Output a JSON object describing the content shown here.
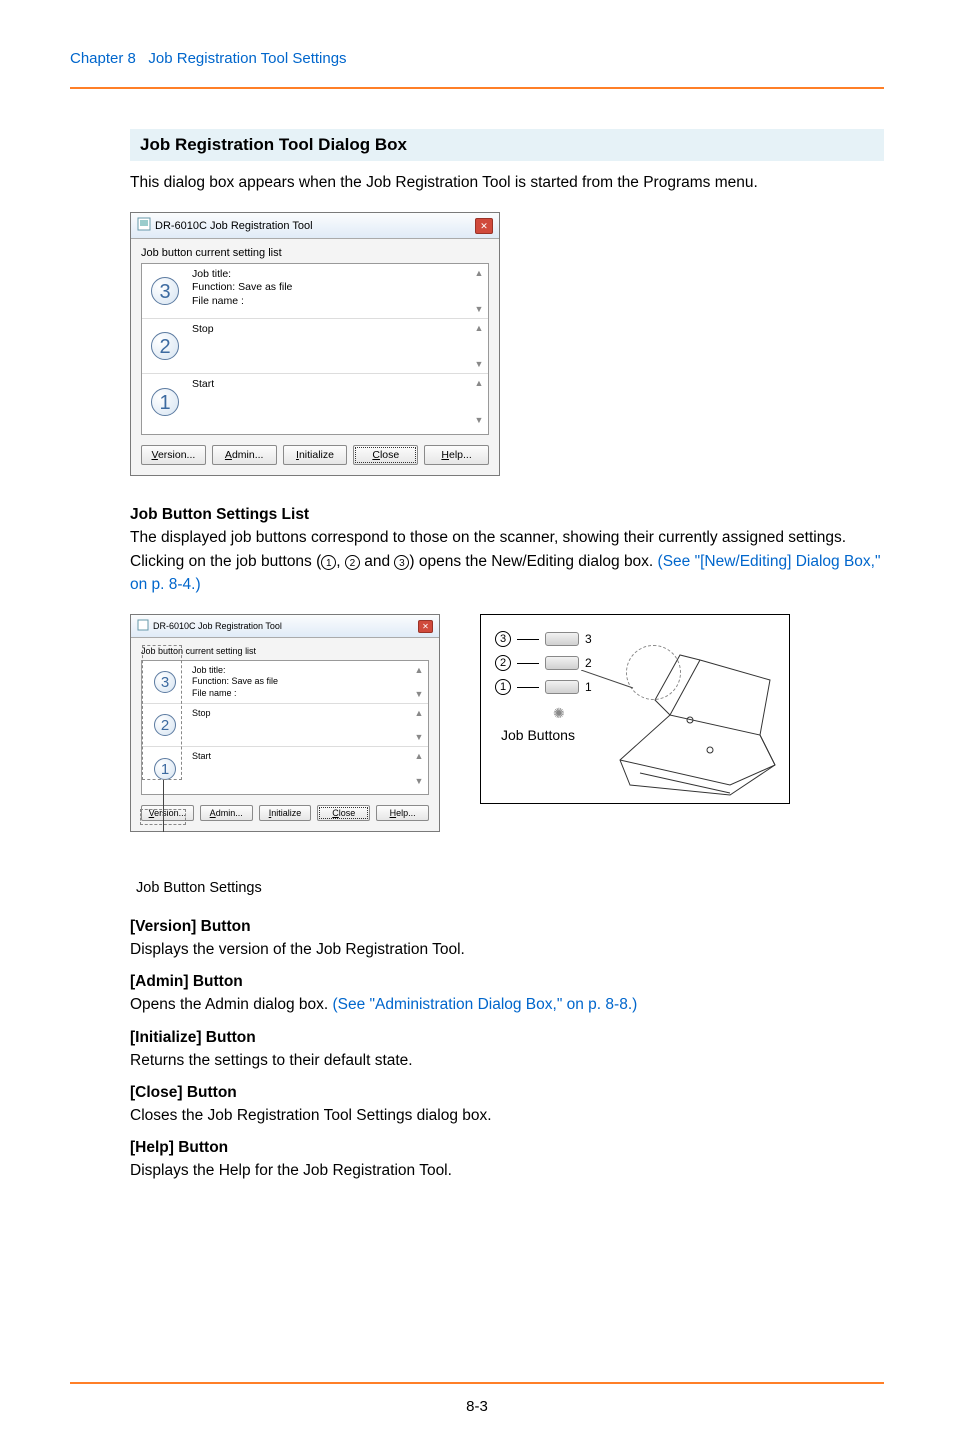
{
  "header": {
    "chapter": "Chapter 8",
    "title": "Job Registration Tool Settings"
  },
  "section_title": "Job Registration Tool Dialog Box",
  "intro": "This dialog box appears when the Job Registration Tool is started from the Programs menu.",
  "dialog": {
    "title": "DR-6010C Job Registration Tool",
    "list_label": "Job button current setting list",
    "rows": [
      {
        "num": "3",
        "text": "Job title:\nFunction: Save as file\nFile name :"
      },
      {
        "num": "2",
        "text": "Stop"
      },
      {
        "num": "1",
        "text": "Start"
      }
    ],
    "buttons": {
      "version": "Version...",
      "admin": "Admin...",
      "initialize": "Initialize",
      "close": "Close",
      "help": "Help..."
    }
  },
  "jobbtn": {
    "heading": "Job Button Settings List",
    "body_a": "The displayed job buttons correspond to those on the scanner, showing their currently assigned settings. Clicking on the job buttons (",
    "c1": "1",
    "sep1": ", ",
    "c2": "2",
    "sep2": " and ",
    "c3": "3",
    "body_b": ") opens the New/Editing dialog box. ",
    "link": "(See \"[New/Editing] Dialog Box,\" on p. 8-4.)"
  },
  "left_caption": "Job Button Settings",
  "scanner": {
    "rows": [
      {
        "circ": "3",
        "num": "3"
      },
      {
        "circ": "2",
        "num": "2"
      },
      {
        "circ": "1",
        "num": "1"
      }
    ],
    "label": "Job Buttons"
  },
  "version": {
    "h": "[Version] Button",
    "p": "Displays the version of the Job Registration Tool."
  },
  "admin": {
    "h": "[Admin] Button",
    "p_a": "Opens the Admin dialog box. ",
    "link": "(See \"Administration Dialog Box,\" on p. 8-8.)"
  },
  "init": {
    "h": "[Initialize] Button",
    "p": "Returns the settings to their default state."
  },
  "close": {
    "h": "[Close] Button",
    "p": "Closes the Job Registration Tool Settings dialog box."
  },
  "help": {
    "h": "[Help] Button",
    "p": "Displays the Help for the Job Registration Tool."
  },
  "page_number": "8-3"
}
